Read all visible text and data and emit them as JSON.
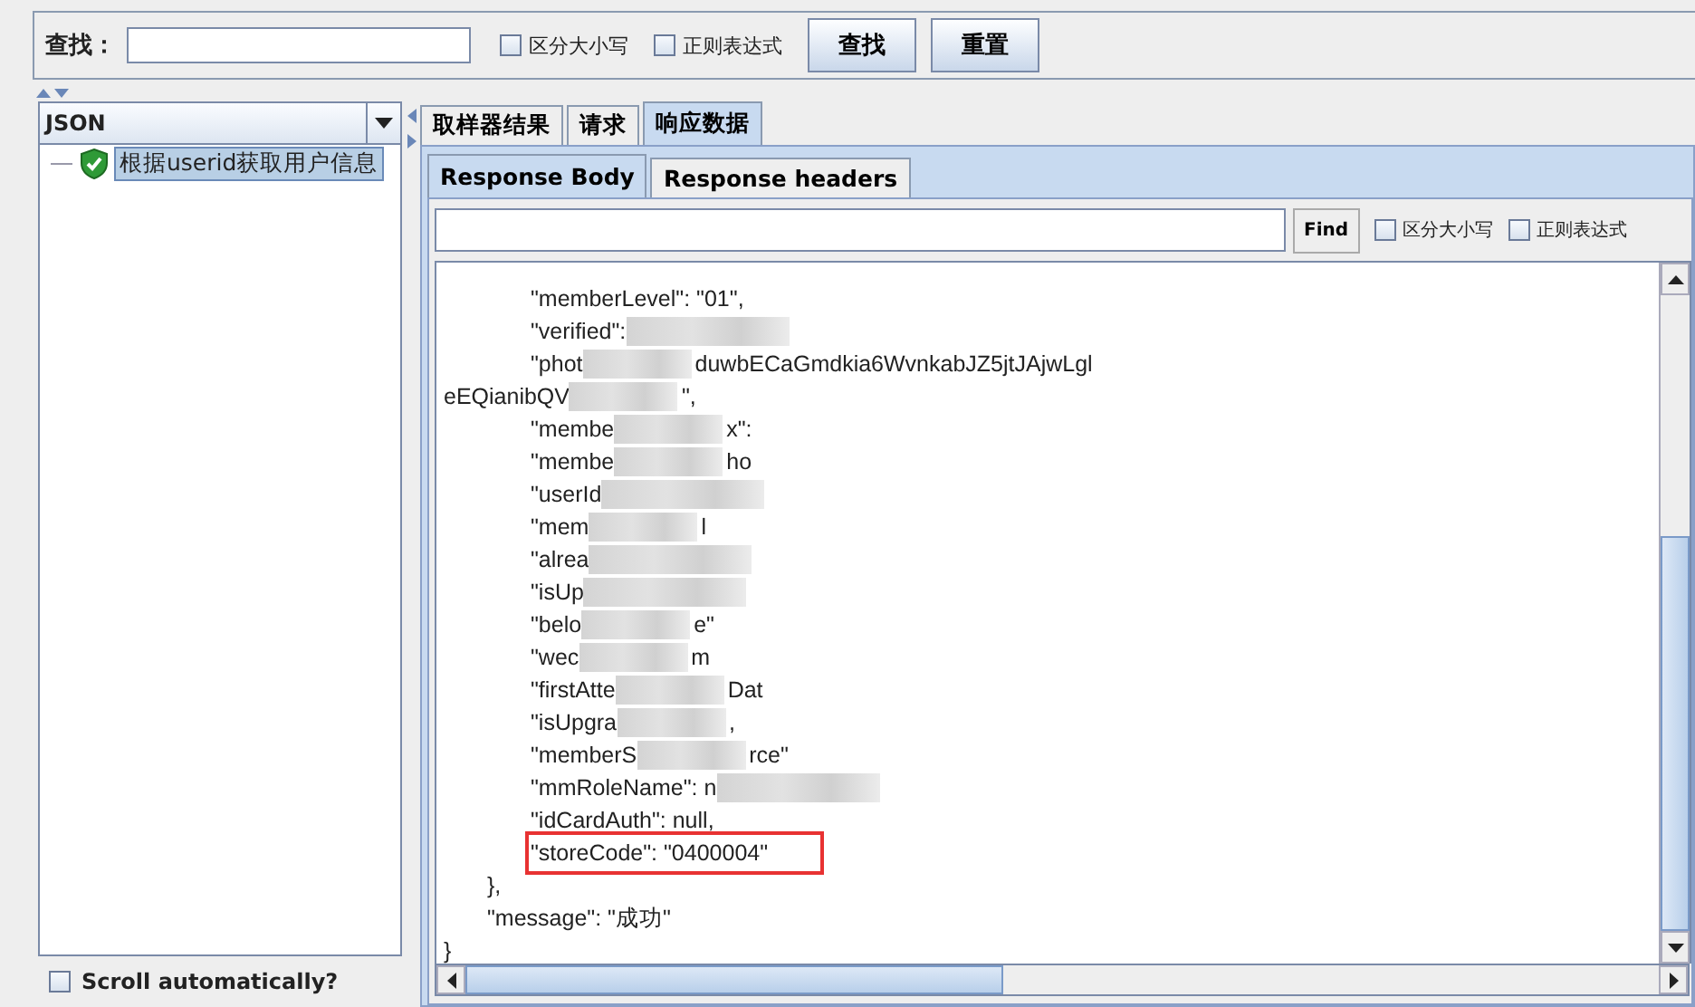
{
  "search_bar": {
    "label": "查找：",
    "options": [
      {
        "label": "区分大小写",
        "checked": false
      },
      {
        "label": "正则表达式",
        "checked": false
      }
    ],
    "buttons": [
      "查找",
      "重置"
    ]
  },
  "renderer": {
    "value": "JSON"
  },
  "tree": [
    {
      "label": "根据userid获取用户信息",
      "selected": true
    }
  ],
  "scroll_automatically": {
    "label": "Scroll automatically?",
    "checked": false
  },
  "tabs": [
    {
      "label": "取样器结果",
      "selected": false
    },
    {
      "label": "请求",
      "selected": false
    },
    {
      "label": "响应数据",
      "selected": true
    }
  ],
  "subtabs": [
    {
      "label": "Response Body",
      "selected": true
    },
    {
      "label": "Response headers",
      "selected": false
    }
  ],
  "find_bar": {
    "button": "Find",
    "options": [
      {
        "label": "区分大小写",
        "checked": false
      },
      {
        "label": "正则表达式",
        "checked": false
      }
    ]
  },
  "response_lines": [
    {
      "kind": "group",
      "children": [
        {
          "kind": "line",
          "text": "\"memberLevel\": \"01\",",
          "redacted": false,
          "highlighted": false
        },
        {
          "kind": "line",
          "text": "\"verified\":",
          "redacted": true,
          "highlighted": false
        },
        {
          "kind": "line",
          "text": "\"phot",
          "tail": "duwbECaGmdkia6WvnkabJZ5jtJAjwLgl",
          "redacted": true,
          "highlighted": false
        },
        {
          "kind": "wrap",
          "text": "eEQianibQV",
          "tail": "\",",
          "redacted": true,
          "highlighted": false
        },
        {
          "kind": "line",
          "text": "\"membe",
          "tail": "x\":",
          "redacted": true,
          "highlighted": false
        },
        {
          "kind": "line",
          "text": "\"membe",
          "tail": "ho",
          "redacted": true,
          "highlighted": false
        },
        {
          "kind": "line",
          "text": "\"userId",
          "redacted": true,
          "highlighted": false
        },
        {
          "kind": "line",
          "text": "\"mem",
          "tail": "l",
          "redacted": true,
          "highlighted": false
        },
        {
          "kind": "line",
          "text": "\"alrea",
          "redacted": true,
          "highlighted": false
        },
        {
          "kind": "line",
          "text": "\"isUp",
          "redacted": true,
          "highlighted": false
        },
        {
          "kind": "line",
          "text": "\"belo",
          "tail": "e\"",
          "redacted": true,
          "highlighted": false
        },
        {
          "kind": "line",
          "text": "\"wec",
          "tail": "m",
          "redacted": true,
          "highlighted": false
        },
        {
          "kind": "line",
          "text": "\"firstAtte",
          "tail": "Dat",
          "redacted": true,
          "highlighted": false
        },
        {
          "kind": "line",
          "text": "\"isUpgra",
          "tail": ",",
          "redacted": true,
          "highlighted": false
        },
        {
          "kind": "line",
          "text": "\"memberS",
          "tail": "rce\"",
          "redacted": true,
          "highlighted": false
        },
        {
          "kind": "line",
          "text": "\"mmRoleName\": n",
          "redacted": true,
          "highlighted": false
        },
        {
          "kind": "line",
          "text": "\"idCardAuth\": null,",
          "redacted": false,
          "highlighted": false
        },
        {
          "kind": "line",
          "text": "\"storeCode\": \"0400004\"",
          "redacted": false,
          "highlighted": true
        }
      ]
    },
    {
      "kind": "line",
      "text": "},",
      "redacted": false,
      "highlighted": false
    },
    {
      "kind": "line",
      "text": "\"message\": \"成功\"",
      "redacted": false,
      "highlighted": false
    }
  ],
  "closing_line": "}"
}
